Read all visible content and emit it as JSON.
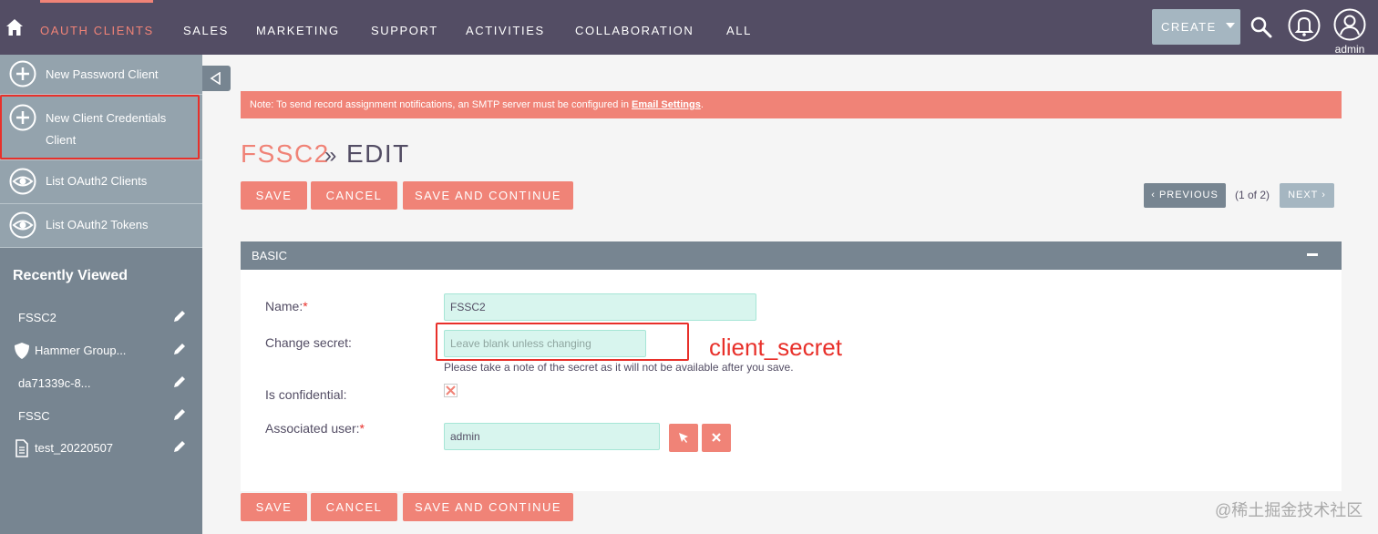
{
  "nav": {
    "items": [
      "OAUTH CLIENTS",
      "SALES",
      "MARKETING",
      "SUPPORT",
      "ACTIVITIES",
      "COLLABORATION",
      "ALL"
    ],
    "active_index": 0,
    "create_label": "CREATE",
    "user_label": "admin",
    "icons": [
      "home-icon",
      "search-icon",
      "bell-icon",
      "user-icon"
    ]
  },
  "sidebar": {
    "actions": [
      {
        "label": "New Password Client",
        "icon": "plus-circle-icon"
      },
      {
        "label_line1": "New Client Credentials",
        "label_line2": "Client",
        "icon": "plus-circle-icon"
      },
      {
        "label": "List OAuth2 Clients",
        "icon": "eye-icon"
      },
      {
        "label": "List OAuth2 Tokens",
        "icon": "eye-icon"
      }
    ],
    "recent_title": "Recently Viewed",
    "recent": [
      {
        "label": "FSSC2",
        "icon": ""
      },
      {
        "label": "Hammer Group...",
        "icon": "shield-icon"
      },
      {
        "label": "da71339c-8...",
        "icon": ""
      },
      {
        "label": "FSSC",
        "icon": ""
      },
      {
        "label": "test_20220507",
        "icon": "document-icon"
      }
    ]
  },
  "notice": {
    "text": "Note: To send record assignment notifications, an SMTP server must be configured in ",
    "link": "Email Settings",
    "suffix": "."
  },
  "title": {
    "module": "FSSC2",
    "separator": "»",
    "action": "EDIT"
  },
  "buttons": {
    "save": "SAVE",
    "cancel": "CANCEL",
    "save_continue": "SAVE AND CONTINUE",
    "previous": "PREVIOUS",
    "next": "NEXT",
    "pager": "(1 of 2)"
  },
  "panel": {
    "title": "BASIC"
  },
  "form": {
    "name_label": "Name:",
    "name_value": "FSSC2",
    "secret_label": "Change secret:",
    "secret_placeholder": "Leave blank unless changing",
    "secret_help": "Please take a note of the secret as it will not be available after you save.",
    "confidential_label": "Is confidential:",
    "user_label": "Associated user:",
    "user_value": "admin",
    "required_mark": "*"
  },
  "annotation": "client_secret",
  "watermark": "@稀土掘金技术社区",
  "colors": {
    "nav_bg": "#534d64",
    "accent": "#f08377",
    "sidebar_bg": "#778591",
    "annotation_red": "#e8302a"
  }
}
